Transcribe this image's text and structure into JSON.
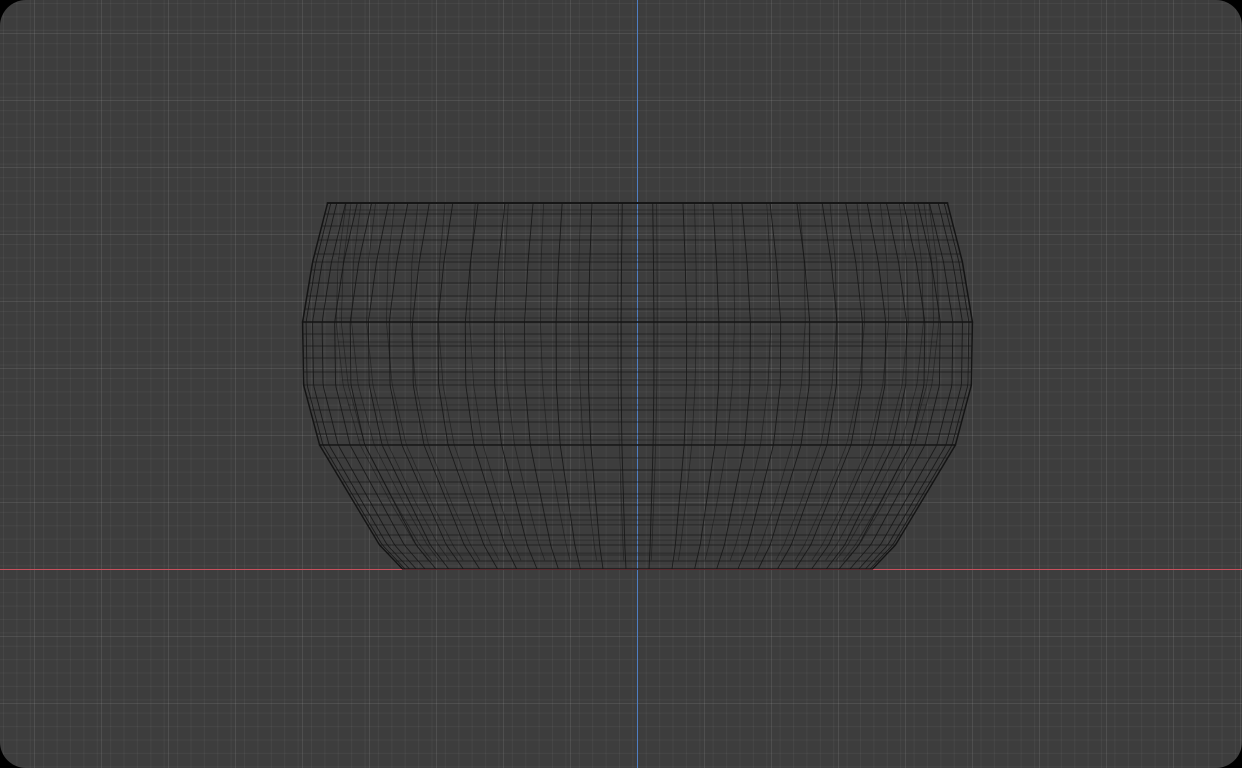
{
  "viewport": {
    "background_color": "#3d3d3d",
    "grid_minor_color": "#444444",
    "grid_major_color": "#4a4a4a",
    "axis_x_color": "#c8505d",
    "axis_z_color": "#4f7ec2",
    "wireframe_color": "#141414"
  },
  "mesh": {
    "object": "bowl-wireframe",
    "view": "front-orthographic",
    "shading": "wireframe"
  }
}
